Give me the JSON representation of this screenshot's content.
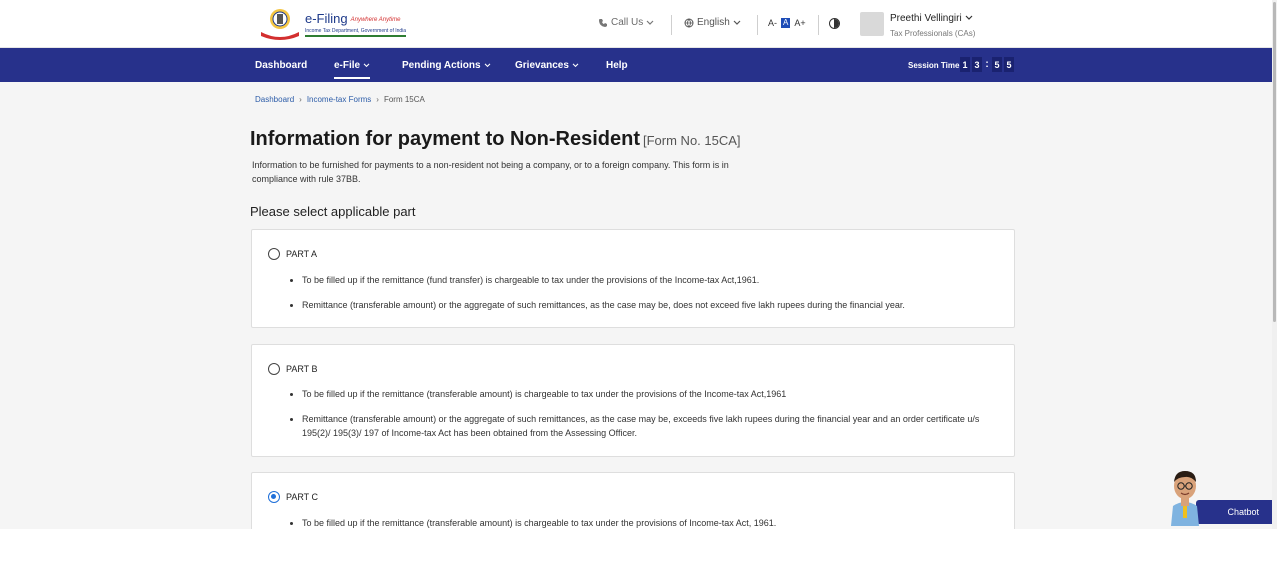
{
  "header": {
    "logo_title": "e-Filing",
    "logo_tagline": "Anywhere Anytime",
    "logo_subtitle": "Income Tax Department, Government of India",
    "call_us": "Call Us",
    "language": "English",
    "font_controls": [
      "A-",
      "A",
      "A+"
    ],
    "user_name": "Preethi Vellingiri",
    "user_role": "Tax Professionals (CAs)"
  },
  "nav": {
    "items": [
      {
        "label": "Dashboard"
      },
      {
        "label": "e-File"
      },
      {
        "label": "Pending Actions"
      },
      {
        "label": "Grievances"
      },
      {
        "label": "Help"
      }
    ],
    "session_label": "Session Time",
    "session_digits": [
      "1",
      "3",
      ":",
      "5",
      "5"
    ]
  },
  "breadcrumb": {
    "items": [
      "Dashboard",
      "Income-tax Forms",
      "Form 15CA"
    ]
  },
  "main": {
    "title": "Information for payment to Non-Resident",
    "form_no": "[Form No. 15CA]",
    "intro": "Information to be furnished for payments to a non-resident not being a company, or to a foreign company. This form is in compliance with rule 37BB.",
    "section_heading": "Please select applicable part",
    "parts": [
      {
        "label": "PART A",
        "selected": false,
        "bullets": [
          "To be filled up if the remittance (fund transfer) is chargeable to tax under the provisions of the Income-tax Act,1961.",
          "Remittance (transferable amount) or the aggregate of such remittances, as the case may be, does not exceed five lakh rupees during the financial year."
        ]
      },
      {
        "label": "PART B",
        "selected": false,
        "bullets": [
          "To be filled up if the remittance (transferable amount) is chargeable to tax under the provisions of the Income-tax Act,1961",
          "Remittance (transferable amount) or the aggregate of such remittances, as the case may be, exceeds five lakh rupees during the financial year and an order certificate u/s 195(2)/ 195(3)/ 197 of Income-tax Act has been obtained from the Assessing Officer."
        ]
      },
      {
        "label": "PART C",
        "selected": true,
        "bullets": [
          "To be filled up if the remittance (transferable amount) is chargeable to tax under the provisions of Income-tax Act, 1961."
        ]
      }
    ]
  },
  "chatbot": {
    "label": "Chatbot"
  },
  "colors": {
    "nav_bg": "#27318b",
    "link": "#2c5ca8",
    "radio_selected": "#1e6fd9"
  }
}
